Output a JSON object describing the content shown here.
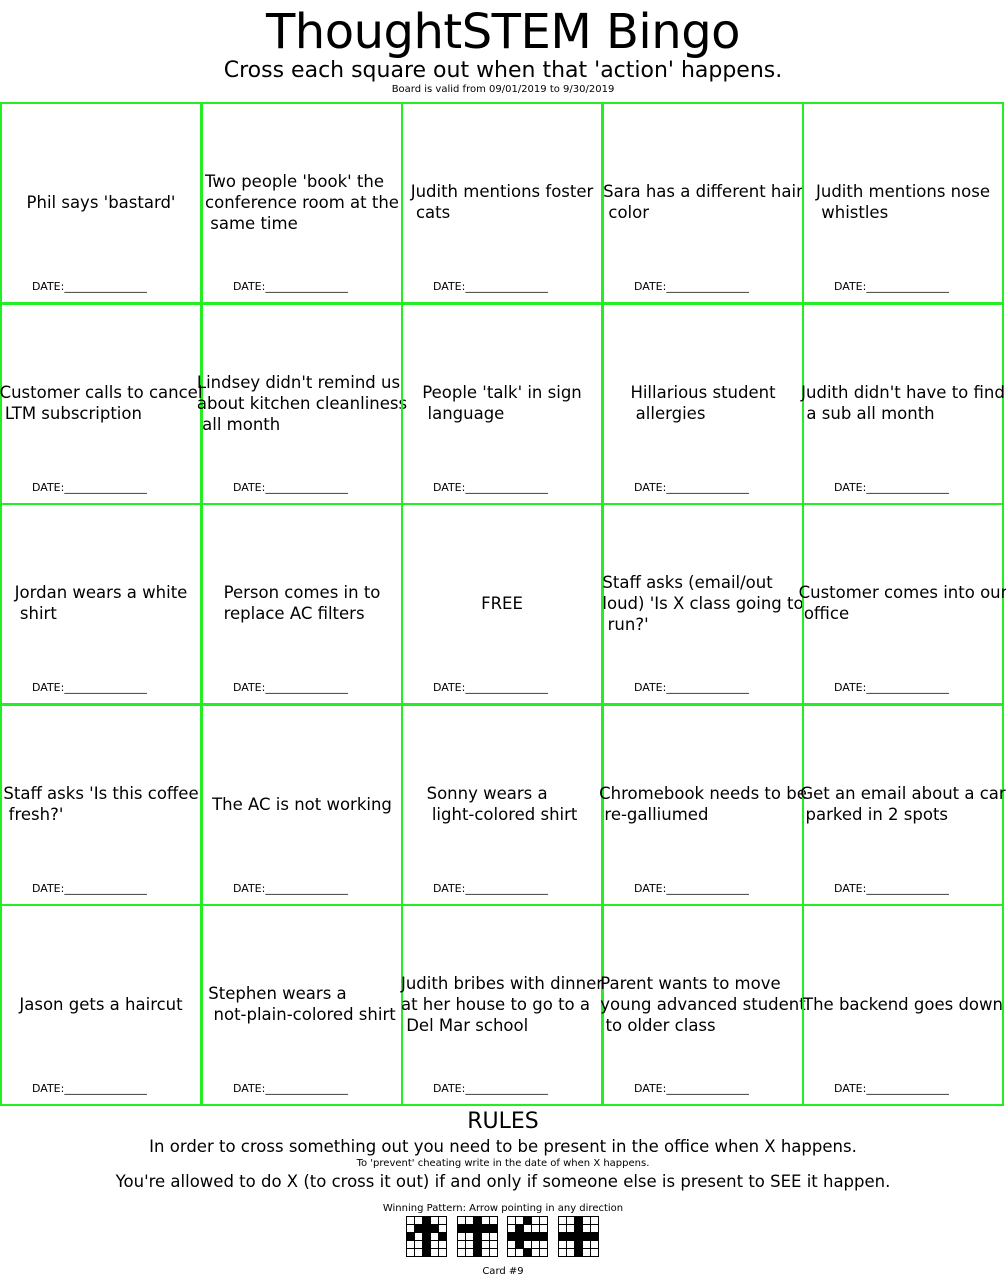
{
  "title": "ThoughtSTEM Bingo",
  "subtitle": "Cross each square out when that 'action' happens.",
  "validity": "Board is valid from 09/01/2019 to 9/30/2019",
  "border_color": "#22ee22",
  "date_label": "DATE:_______________",
  "cells": [
    "Phil says 'bastard'",
    "Two people 'book' the\nconference room at the\n same time",
    "Judith mentions foster\n cats",
    "Sara has a different hair\n color",
    "Judith mentions nose\n whistles",
    "Customer calls to cancel\n LTM subscription",
    "Lindsey didn't remind us\nabout kitchen cleanliness\n all month",
    "People 'talk' in sign\n language",
    "Hillarious student\n allergies",
    "Judith didn't have to find\n a sub all month",
    "Jordan wears a white\n shirt",
    "Person comes in to\nreplace AC filters",
    "FREE",
    "Staff asks (email/out\nloud) 'Is X class going to\n run?'",
    "Customer comes into our\n office",
    "Staff asks 'Is this coffee\n fresh?'",
    "The AC is not working",
    "Sonny wears a\n light-colored shirt",
    "Chromebook needs to be\n re-galliumed",
    "Get an email about a car\n parked in 2 spots",
    "Jason gets a haircut",
    "Stephen wears a\n not-plain-colored shirt",
    "Judith bribes with dinner\nat her house to go to a\n Del Mar school",
    "Parent wants to move\nyoung advanced student\n to older class",
    "The backend goes down"
  ],
  "rules": {
    "title": "RULES",
    "line1": "In order to cross something out you need to be present in the office when X happens.",
    "line2": "To 'prevent' cheating write in the date of when X happens.",
    "line3": "You're allowed to do X (to cross it out) if and only if someone else is present to SEE it happen."
  },
  "winning_pattern": {
    "label": "Winning Pattern: Arrow pointing in any direction",
    "patterns": [
      [
        [
          0,
          0,
          1,
          0,
          0
        ],
        [
          0,
          1,
          1,
          1,
          0
        ],
        [
          1,
          0,
          1,
          0,
          1
        ],
        [
          0,
          0,
          1,
          0,
          0
        ],
        [
          0,
          0,
          1,
          0,
          0
        ]
      ],
      [
        [
          0,
          0,
          1,
          0,
          0
        ],
        [
          1,
          1,
          1,
          1,
          1
        ],
        [
          0,
          0,
          1,
          0,
          0
        ],
        [
          0,
          0,
          1,
          0,
          0
        ],
        [
          0,
          0,
          1,
          0,
          0
        ]
      ],
      [
        [
          0,
          0,
          1,
          0,
          0
        ],
        [
          0,
          1,
          0,
          0,
          0
        ],
        [
          1,
          1,
          1,
          1,
          1
        ],
        [
          0,
          1,
          0,
          0,
          0
        ],
        [
          0,
          0,
          1,
          0,
          0
        ]
      ],
      [
        [
          0,
          0,
          1,
          0,
          0
        ],
        [
          0,
          0,
          1,
          0,
          0
        ],
        [
          1,
          1,
          1,
          1,
          1
        ],
        [
          0,
          0,
          1,
          0,
          0
        ],
        [
          0,
          0,
          1,
          0,
          0
        ]
      ]
    ]
  },
  "card_number": "Card #9"
}
